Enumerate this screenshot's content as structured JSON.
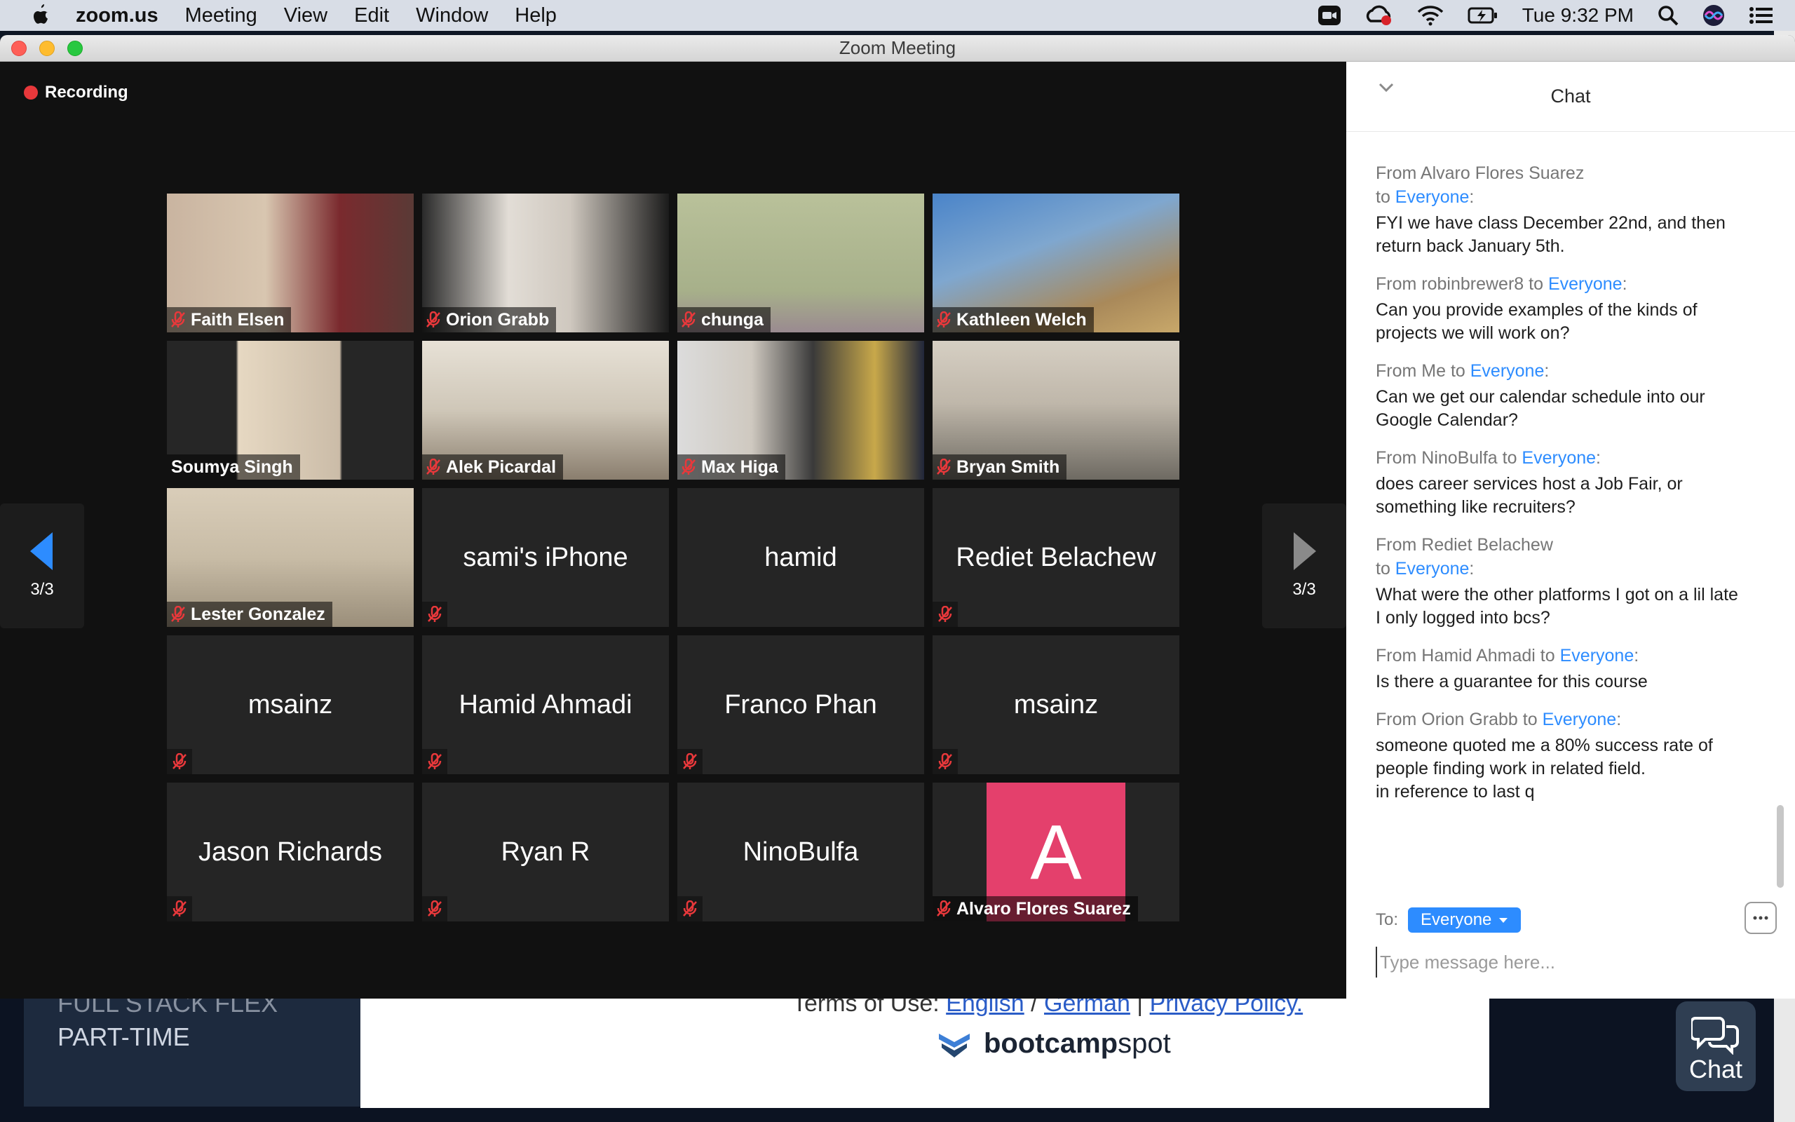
{
  "menubar": {
    "app": "zoom.us",
    "items": [
      "Meeting",
      "View",
      "Edit",
      "Window",
      "Help"
    ],
    "clock": "Tue 9:32 PM"
  },
  "window": {
    "title": "Zoom Meeting"
  },
  "meeting": {
    "recording_label": "Recording",
    "page_indicator_left": "3/3",
    "page_indicator_right": "3/3",
    "tiles": [
      {
        "name": "Faith Elsen",
        "video": true,
        "muted": true
      },
      {
        "name": "Orion Grabb",
        "video": true,
        "muted": true
      },
      {
        "name": "chunga",
        "video": true,
        "muted": true
      },
      {
        "name": "Kathleen Welch",
        "video": true,
        "muted": true
      },
      {
        "name": "Soumya Singh",
        "video": true,
        "muted": false
      },
      {
        "name": "Alek Picardal",
        "video": true,
        "muted": true
      },
      {
        "name": "Max Higa",
        "video": true,
        "muted": true
      },
      {
        "name": "Bryan Smith",
        "video": true,
        "muted": true
      },
      {
        "name": "Lester Gonzalez",
        "video": true,
        "muted": true
      },
      {
        "name": "sami's iPhone",
        "video": false,
        "muted": true
      },
      {
        "name": "hamid",
        "video": false,
        "muted": false
      },
      {
        "name": "Rediet Belachew",
        "video": false,
        "muted": true
      },
      {
        "name": "msainz",
        "video": false,
        "muted": true
      },
      {
        "name": "Hamid Ahmadi",
        "video": false,
        "muted": true
      },
      {
        "name": "Franco Phan",
        "video": false,
        "muted": true
      },
      {
        "name": "msainz",
        "video": false,
        "muted": true
      },
      {
        "name": "Jason Richards",
        "video": false,
        "muted": true
      },
      {
        "name": "Ryan R",
        "video": false,
        "muted": true
      },
      {
        "name": "NinoBulfa",
        "video": false,
        "muted": true
      },
      {
        "name": "Alvaro Flores Suarez",
        "video": false,
        "muted": true,
        "avatar_letter": "A"
      }
    ]
  },
  "chat": {
    "title": "Chat",
    "messages": [
      {
        "from": "From Alvaro Flores Suarez",
        "to_prefix": "to ",
        "to": "Everyone",
        "to_newline": true,
        "text": "FYI we have class December 22nd, and then return back January 5th."
      },
      {
        "from": "From robinbrewer8",
        "to_prefix": " to ",
        "to": "Everyone",
        "to_newline": false,
        "text": "Can you provide examples of the kinds of projects we will work on?"
      },
      {
        "from": "From Me",
        "to_prefix": " to ",
        "to": "Everyone",
        "to_newline": false,
        "text": "Can we get our calendar schedule into our Google Calendar?"
      },
      {
        "from": "From NinoBulfa",
        "to_prefix": " to ",
        "to": "Everyone",
        "to_newline": false,
        "text": "does career services host a Job Fair, or something like recruiters?"
      },
      {
        "from": "From Rediet Belachew",
        "to_prefix": "to ",
        "to": "Everyone",
        "to_newline": true,
        "text": "What were the other platforms I  got on a lil late I only logged into bcs?"
      },
      {
        "from": "From Hamid Ahmadi",
        "to_prefix": " to ",
        "to": "Everyone",
        "to_newline": false,
        "text": "Is there a guarantee for this course"
      },
      {
        "from": "From Orion Grabb",
        "to_prefix": " to ",
        "to": "Everyone",
        "to_newline": false,
        "text": "someone quoted me a 80% success rate of people finding work in related field.\nin reference to last q"
      }
    ],
    "to_label": "To:",
    "to_select": "Everyone",
    "input_placeholder": "Type message here..."
  },
  "background_page": {
    "sidebar_line1": "FULL STACK FLEX",
    "sidebar_line2": "PART-TIME",
    "terms_prefix": "Terms of Use: ",
    "terms_english": "English",
    "terms_sep1": " / ",
    "terms_german": "German",
    "terms_sep2": " | ",
    "terms_privacy": "Privacy Policy.",
    "logo_bold": "bootcamp",
    "logo_rest": "spot",
    "chat_button": "Chat"
  }
}
